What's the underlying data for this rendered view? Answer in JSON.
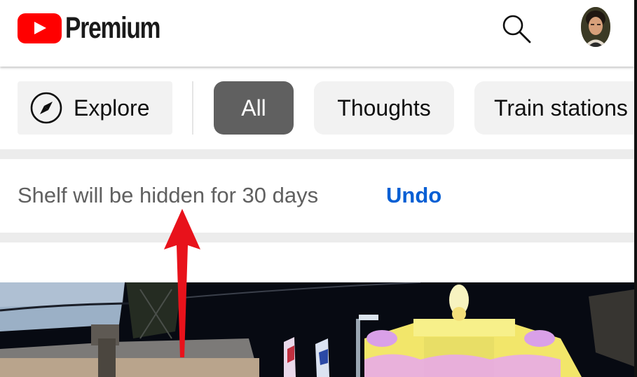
{
  "header": {
    "logo_text": "Premium"
  },
  "chips": [
    {
      "label": "Explore"
    },
    {
      "label": "All",
      "selected": true
    },
    {
      "label": "Thoughts"
    },
    {
      "label": "Train stations"
    }
  ],
  "notice": {
    "message": "Shelf will be hidden for 30 days",
    "action": "Undo"
  },
  "icons": {
    "logo": "youtube-play-icon",
    "search": "search-icon",
    "explore": "compass-icon",
    "annotation": "red-arrow-up-icon"
  },
  "colors": {
    "brand_red": "#ff0000",
    "link_blue": "#065fd4",
    "selected_chip": "#606060",
    "arrow_red": "#e8121b"
  }
}
